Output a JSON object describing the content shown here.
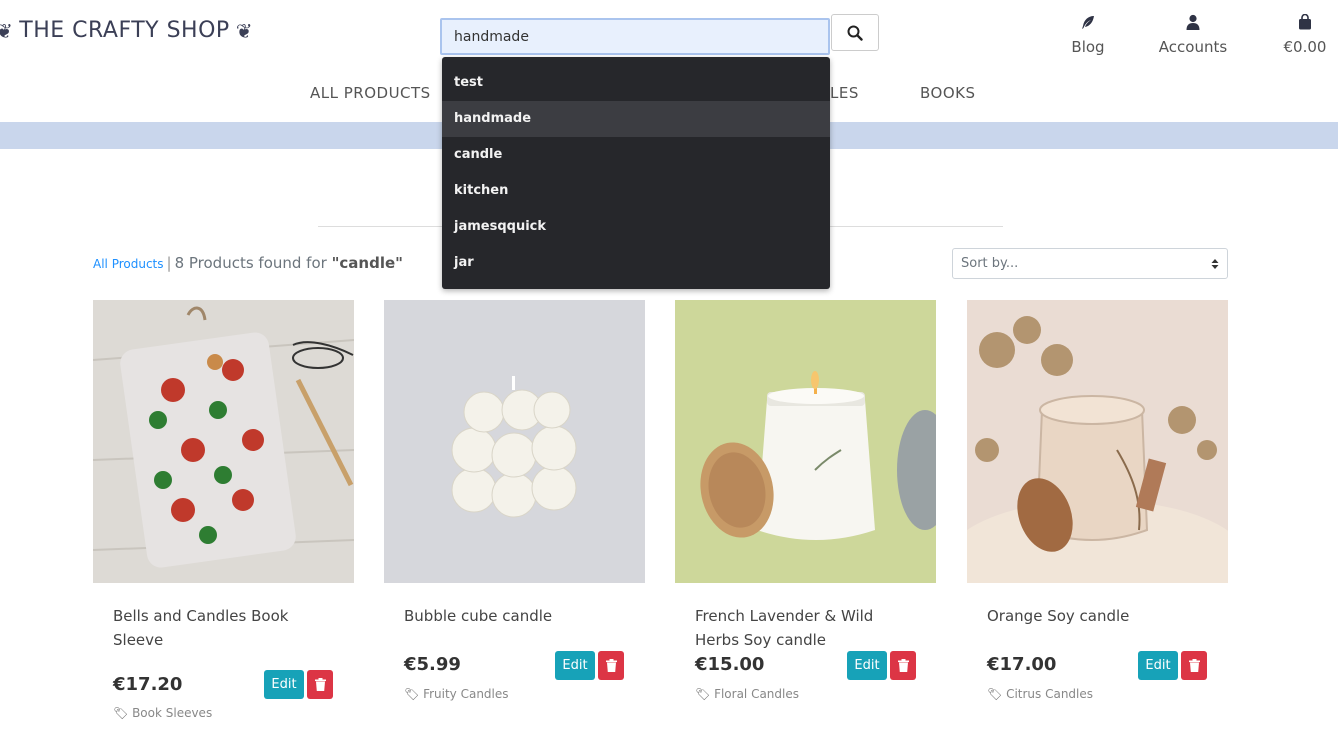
{
  "header": {
    "logo_text": "THE CRAFTY SHOP",
    "search": {
      "value": "handmade",
      "placeholder": ""
    },
    "links": [
      {
        "label": "Blog",
        "icon": "feather-icon"
      },
      {
        "label": "Accounts",
        "icon": "user-icon"
      },
      {
        "label": "€0.00",
        "icon": "shopping-bag-icon"
      }
    ]
  },
  "nav": {
    "items": [
      "ALL PRODUCTS",
      "LES",
      "BOOKS"
    ]
  },
  "autocomplete": {
    "items": [
      "test",
      "handmade",
      "candle",
      "kitchen",
      "jamesqquick",
      "jar"
    ],
    "active_index": 1
  },
  "results": {
    "all_products_link": "All Products",
    "separator": "|",
    "count_text": "8 Products found for",
    "query": "\"candle\""
  },
  "sort": {
    "label": "Sort by..."
  },
  "products": [
    {
      "name": "Bells and Candles Book Sleeve",
      "price": "€17.20",
      "category": "Book Sleeves",
      "edit_label": "Edit"
    },
    {
      "name": "Bubble cube candle",
      "price": "€5.99",
      "category": "Fruity Candles",
      "edit_label": "Edit"
    },
    {
      "name": "French Lavender & Wild Herbs Soy candle",
      "price": "€15.00",
      "category": "Floral Candles",
      "edit_label": "Edit"
    },
    {
      "name": "Orange Soy candle",
      "price": "€17.00",
      "category": "Citrus Candles",
      "edit_label": "Edit"
    }
  ],
  "colors": {
    "brand": "#3b3f56",
    "banner": "#c9d6ec",
    "edit": "#17a2b8",
    "delete": "#dc3545",
    "dropdown_bg": "#26272b"
  }
}
